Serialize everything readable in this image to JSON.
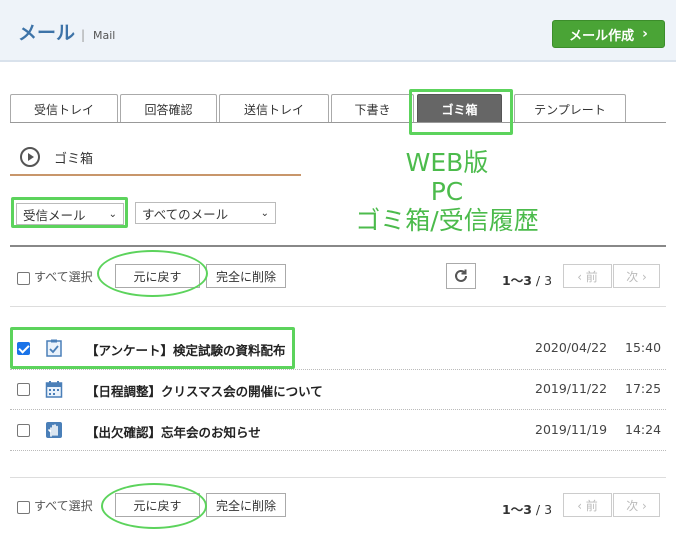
{
  "header": {
    "title": "メール",
    "separator": "|",
    "subtitle": "Mail",
    "compose_label": "メール作成",
    "compose_chevron": "›"
  },
  "tabs": [
    {
      "label": "受信トレイ",
      "active": false
    },
    {
      "label": "回答確認",
      "active": false
    },
    {
      "label": "送信トレイ",
      "active": false
    },
    {
      "label": "下書き",
      "active": false
    },
    {
      "label": "ゴミ箱",
      "active": true
    },
    {
      "label": "テンプレート",
      "active": false
    }
  ],
  "section": {
    "title": "ゴミ箱"
  },
  "filters": {
    "box_select": "受信メール",
    "mail_select": "すべてのメール",
    "caret": "⌄"
  },
  "annotation": [
    "WEB版",
    "PC",
    "ゴミ箱/受信履歴"
  ],
  "toolbar": {
    "select_all": "すべて選択",
    "restore": "元に戻す",
    "delete_all": "完全に削除",
    "count_range": "1〜3",
    "count_total": "/ 3",
    "prev": "‹ 前",
    "next": "次 ›"
  },
  "mails": [
    {
      "subject": "【アンケート】検定試験の資料配布",
      "date": "2020/04/22",
      "time": "15:40",
      "checked": true,
      "icon": "survey-icon"
    },
    {
      "subject": "【日程調整】クリスマス会の開催について",
      "date": "2019/11/22",
      "time": "17:25",
      "checked": false,
      "icon": "calendar-icon"
    },
    {
      "subject": "【出欠確認】忘年会のお知らせ",
      "date": "2019/11/19",
      "time": "14:24",
      "checked": false,
      "icon": "hand-icon"
    }
  ],
  "colors": {
    "accent_green": "#4aa436",
    "annotation_green": "#4cbb4c",
    "title_blue": "#3d73a8",
    "active_tab": "#666666"
  }
}
